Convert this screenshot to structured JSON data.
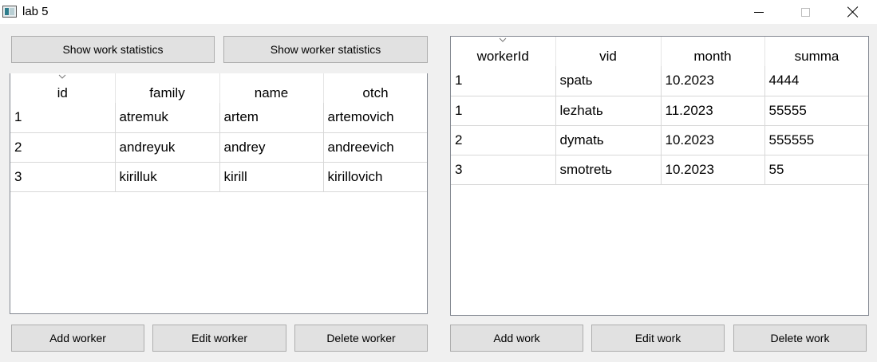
{
  "window": {
    "title": "lab 5",
    "icon": "app-window-icon"
  },
  "left": {
    "buttons": {
      "show_work_stats": "Show work statistics",
      "show_worker_stats": "Show worker statistics",
      "add": "Add worker",
      "edit": "Edit worker",
      "delete": "Delete worker"
    },
    "table": {
      "columns": [
        "id",
        "family",
        "name",
        "otch"
      ],
      "rows": [
        [
          "1",
          "atremuk",
          "artem",
          "artemovich"
        ],
        [
          "2",
          "andreyuk",
          "andrey",
          "andreevich"
        ],
        [
          "3",
          "kirilluk",
          "kirill",
          "kirillovich"
        ]
      ]
    }
  },
  "right": {
    "buttons": {
      "add": "Add work",
      "edit": "Edit work",
      "delete": "Delete work"
    },
    "table": {
      "columns": [
        "workerId",
        "vid",
        "month",
        "summa"
      ],
      "rows": [
        [
          "1",
          "spatь",
          "10.2023",
          "4444"
        ],
        [
          "1",
          "lezhatь",
          "11.2023",
          "55555"
        ],
        [
          "2",
          "dymatь",
          "10.2023",
          "555555"
        ],
        [
          "3",
          "smotretь",
          "10.2023",
          "55"
        ]
      ]
    }
  }
}
